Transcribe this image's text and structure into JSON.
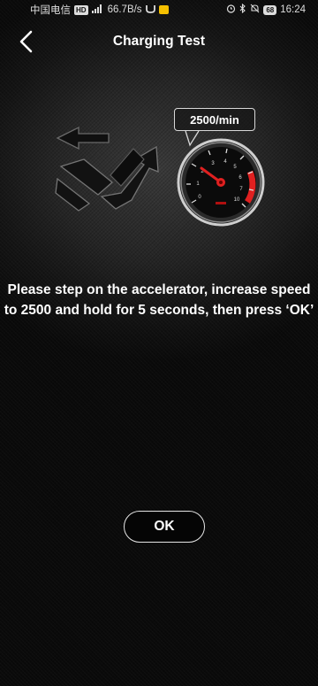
{
  "status_bar": {
    "carrier": "中国电信",
    "network_speed": "66.7B/s",
    "battery": "68",
    "time": "16:24"
  },
  "nav": {
    "title": "Charging Test",
    "back_icon": "chevron-left-icon"
  },
  "illustration": {
    "pedal_icon": "accelerator-pedal-icon",
    "gauge_icon": "tachometer-icon",
    "speed_label": "2500/min"
  },
  "instruction": "Please step on the accelerator, increase speed to 2500 and hold for 5 seconds, then press ‘OK’",
  "ok_button": "OK",
  "colors": {
    "background": "#0a0a0a",
    "text": "#ffffff",
    "gauge_red": "#e02020"
  }
}
